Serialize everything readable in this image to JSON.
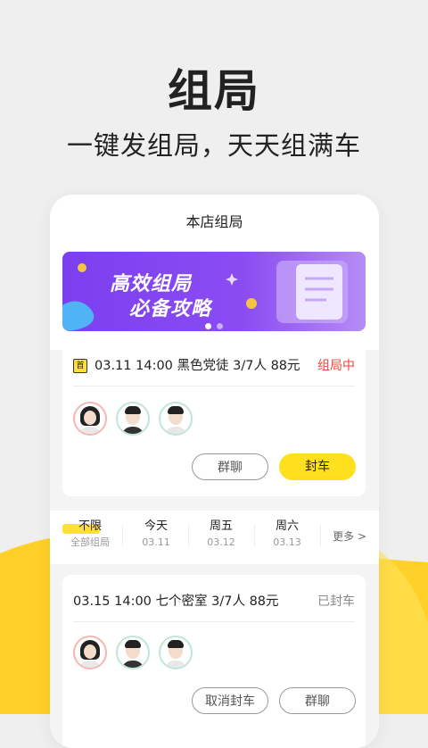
{
  "hero": {
    "title": "组局",
    "subtitle": "一键发组局，天天组满车"
  },
  "colors": {
    "accent_yellow": "#ffe01f",
    "background_yellow": "#ffd027",
    "banner_purple": "#7b3ff0",
    "status_red": "#f0453b"
  },
  "screen": {
    "header_title": "本店组局",
    "banner": {
      "line1": "高效组局",
      "line2": "必备攻略",
      "page_count": 2,
      "active_page": 1
    },
    "featured_game": {
      "badge": "首",
      "info": "03.11 14:00  黑色党徒  3/7人  88元",
      "status": "组局中",
      "players": [
        {
          "avatar": "female-avatar"
        },
        {
          "avatar": "male-avatar"
        },
        {
          "avatar": "male-avatar"
        }
      ],
      "btn_chat": "群聊",
      "btn_close": "封车"
    },
    "filters": [
      {
        "label": "不限",
        "sub": "全部组局",
        "active": true
      },
      {
        "label": "今天",
        "sub": "03.11",
        "active": false
      },
      {
        "label": "周五",
        "sub": "03.12",
        "active": false
      },
      {
        "label": "周六",
        "sub": "03.13",
        "active": false
      }
    ],
    "filter_more": "更多 >",
    "game2": {
      "info": "03.15 14:00  七个密室  3/7人  88元",
      "status": "已封车",
      "btn_cancel": "取消封车",
      "btn_chat": "群聊"
    }
  }
}
